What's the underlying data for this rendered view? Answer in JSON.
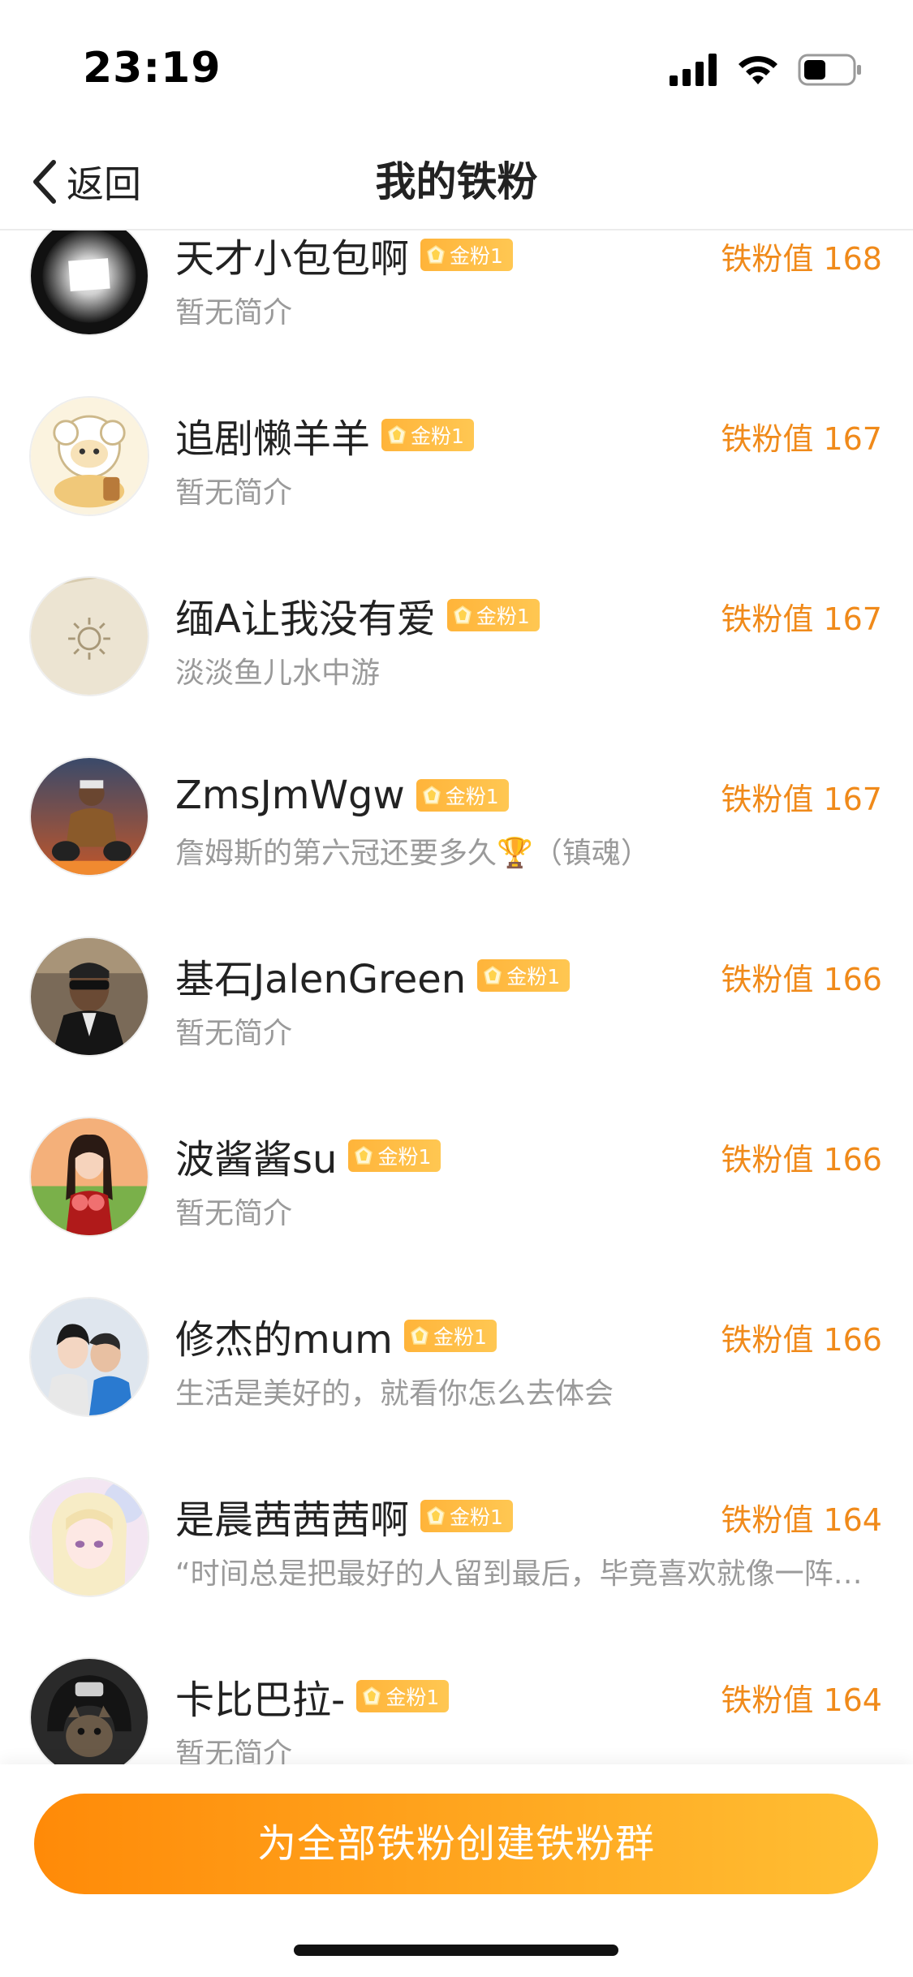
{
  "status_bar": {
    "time": "23:19",
    "icons": [
      "cellular-signal-icon",
      "wifi-icon",
      "battery-icon"
    ]
  },
  "nav": {
    "back_label": "返回",
    "title": "我的铁粉"
  },
  "fans": [
    {
      "name": "天才小包包啊",
      "badge": "金粉1",
      "bio": "暂无简介",
      "score": "铁粉值 168",
      "avatar": "light-panel"
    },
    {
      "name": "追剧懒羊羊",
      "badge": "金粉1",
      "bio": "暂无简介",
      "score": "铁粉值 167",
      "avatar": "cartoon-sheep"
    },
    {
      "name": "缅A让我没有爱",
      "badge": "金粉1",
      "bio": "淡淡鱼儿水中游",
      "score": "铁粉值 167",
      "avatar": "sand-sun"
    },
    {
      "name": "ZmsJmWgw",
      "badge": "金粉1",
      "bio": "詹姆斯的第六冠还要多久🏆（镇魂）",
      "score": "铁粉值 167",
      "avatar": "rider"
    },
    {
      "name": "基石JalenGreen",
      "badge": "金粉1",
      "bio": "暂无简介",
      "score": "铁粉值 166",
      "avatar": "man-sunglasses"
    },
    {
      "name": "波酱酱su",
      "badge": "金粉1",
      "bio": "暂无简介",
      "score": "铁粉值 166",
      "avatar": "girl-peaches"
    },
    {
      "name": "修杰的mum",
      "badge": "金粉1",
      "bio": "生活是美好的，就看你怎么去体会",
      "score": "铁粉值 166",
      "avatar": "mother-child"
    },
    {
      "name": "是晨茜茜茜啊",
      "badge": "金粉1",
      "bio": "“时间总是把最好的人留到最后，毕竟喜欢就像一阵…",
      "score": "铁粉值 164",
      "avatar": "anime-girl"
    },
    {
      "name": "卡比巴拉-",
      "badge": "金粉1",
      "bio": "暂无简介",
      "score": "铁粉值 164",
      "avatar": "cat-helmet"
    }
  ],
  "cta": {
    "label": "为全部铁粉创建铁粉群"
  },
  "colors": {
    "accent_orange": "#f08a1a",
    "badge_gold": "#ffb43a",
    "cta_gradient_start": "#ff8a08",
    "cta_gradient_end": "#ffbf34",
    "bio_gray": "#9a9a9a"
  }
}
